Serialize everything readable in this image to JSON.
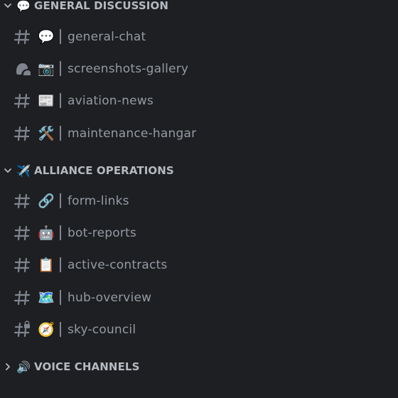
{
  "categories": [
    {
      "name": "GENERAL DISCUSSION",
      "emoji": "💬",
      "collapsed": false,
      "channels": [
        {
          "type": "text",
          "emoji": "💬",
          "name": "general-chat"
        },
        {
          "type": "forum",
          "emoji": "📷",
          "name": "screenshots-gallery"
        },
        {
          "type": "text",
          "emoji": "📰",
          "name": "aviation-news"
        },
        {
          "type": "text",
          "emoji": "🛠️",
          "name": "maintenance-hangar"
        }
      ]
    },
    {
      "name": "ALLIANCE OPERATIONS",
      "emoji": "✈️",
      "collapsed": false,
      "channels": [
        {
          "type": "text",
          "emoji": "🔗",
          "name": "form-links"
        },
        {
          "type": "text",
          "emoji": "🤖",
          "name": "bot-reports"
        },
        {
          "type": "text",
          "emoji": "📋",
          "name": "active-contracts"
        },
        {
          "type": "text",
          "emoji": "🗺️",
          "name": "hub-overview"
        },
        {
          "type": "text-locked",
          "emoji": "🧭",
          "name": "sky-council"
        }
      ]
    },
    {
      "name": "VOICE CHANNELS",
      "emoji": "🔊",
      "collapsed": true,
      "channels": []
    }
  ],
  "colors": {
    "background": "#1e1f22",
    "category_text": "#b5bac1",
    "channel_text": "#949ba4",
    "icon": "#80848e"
  }
}
